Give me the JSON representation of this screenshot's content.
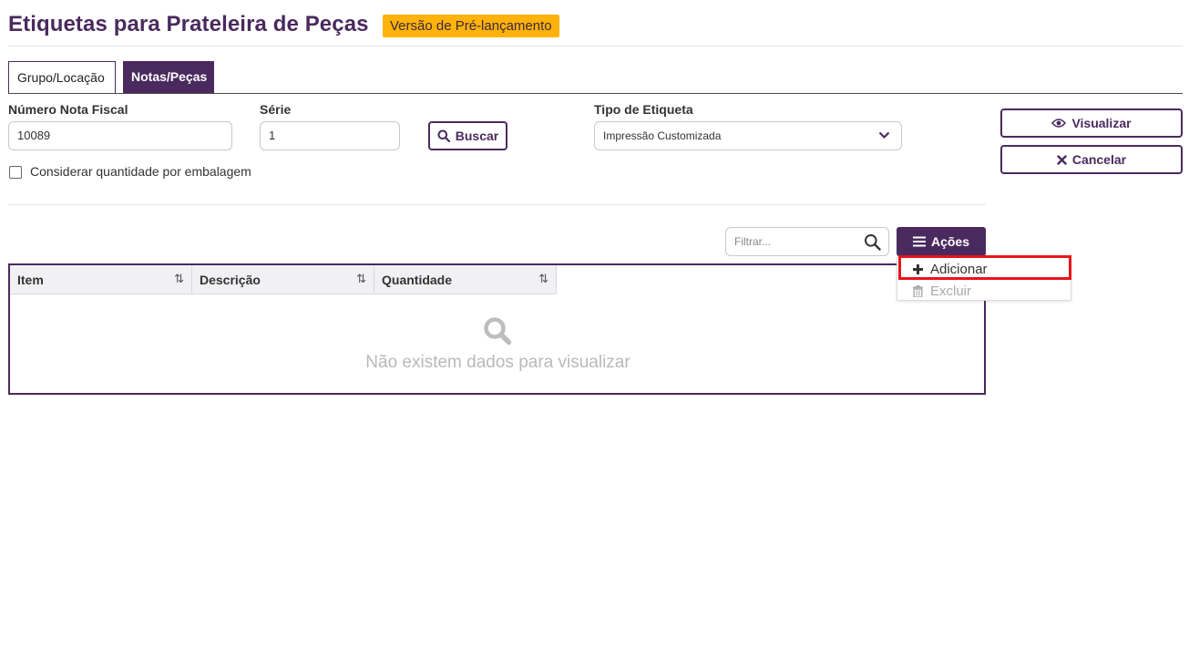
{
  "page": {
    "title": "Etiquetas para Prateleira de Peças",
    "badge": "Versão de Pré-lançamento"
  },
  "tabs": [
    {
      "label": "Grupo/Locação",
      "active": false
    },
    {
      "label": "Notas/Peças",
      "active": true
    }
  ],
  "form": {
    "nota_fiscal": {
      "label": "Número Nota Fiscal",
      "value": "10089"
    },
    "serie": {
      "label": "Série",
      "value": "1"
    },
    "buscar_label": "Buscar",
    "tipo_etiqueta": {
      "label": "Tipo de Etiqueta",
      "value": "Impressão Customizada"
    },
    "considerar_label": "Considerar quantidade por embalagem"
  },
  "side_buttons": {
    "visualizar": "Visualizar",
    "cancelar": "Cancelar"
  },
  "toolbar": {
    "filter_placeholder": "Filtrar...",
    "acoes_label": "Ações"
  },
  "grid": {
    "columns": [
      "Item",
      "Descrição",
      "Quantidade"
    ],
    "sort_glyph": "⇅",
    "empty_text": "Não existem dados para visualizar"
  },
  "actions_menu": {
    "items": [
      {
        "label": "Adicionar",
        "icon": "plus-icon",
        "enabled": true
      },
      {
        "label": "Excluir",
        "icon": "trash-icon",
        "enabled": false
      }
    ]
  },
  "colors": {
    "brand": "#4a2a5e",
    "badge": "#ffb20a",
    "highlight": "#e8141c"
  }
}
